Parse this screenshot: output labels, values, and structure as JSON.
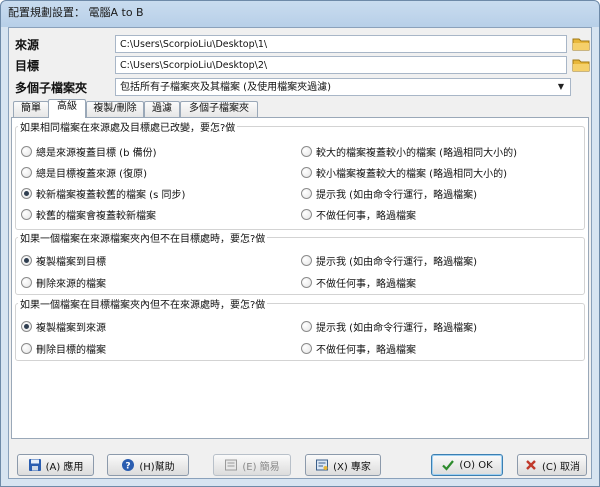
{
  "window": {
    "title": "配置規劃設置： 電腦A to B"
  },
  "rows": {
    "source_label": "來源",
    "source_path": "C:\\Users\\ScorpioLiu\\Desktop\\1\\",
    "target_label": "目標",
    "target_path": "C:\\Users\\ScorpioLiu\\Desktop\\2\\",
    "subfolders_label": "多個子檔案夾",
    "subfolders_value": "包括所有子檔案夾及其檔案 (及使用檔案夾過濾)"
  },
  "tabs": [
    "簡單",
    "高級",
    "複製/刪除",
    "過濾",
    "多個子檔案夾"
  ],
  "groups": {
    "changed": {
      "title": "如果相同檔案在來源處及目標處已改變，要怎?做",
      "left": [
        "總是來源複蓋目標 (b 備份)",
        "總是目標複蓋來源 (復原)",
        "較新檔案複蓋較舊的檔案 (s 同步)",
        "較舊的檔案會複蓋較新檔案"
      ],
      "right": [
        "較大的檔案複蓋較小的檔案 (略過相同大小的)",
        "較小檔案複蓋較大的檔案 (略過相同大小的)",
        "提示我 (如由命令行運行，略過檔案)",
        "不做任何事，略過檔案"
      ]
    },
    "source_only": {
      "title": "如果一個檔案在來源檔案夾內但不在目標處時，要怎?做",
      "left": [
        "複製檔案到目標",
        "刪除來源的檔案"
      ],
      "right": [
        "提示我 (如由命令行運行，略過檔案)",
        "不做任何事，略過檔案"
      ]
    },
    "target_only": {
      "title": "如果一個檔案在目標檔案夾內但不在來源處時，要怎?做",
      "left": [
        "複製檔案到來源",
        "刪除目標的檔案"
      ],
      "right": [
        "提示我 (如由命令行運行，略過檔案)",
        "不做任何事，略過檔案"
      ]
    }
  },
  "buttons": {
    "apply": "(A) 應用",
    "help": "(H)幫助",
    "simple": "(E) 簡易",
    "expert": "(X) 專家",
    "ok": "(O) OK",
    "cancel": "(C) 取消"
  },
  "colors": {
    "selection": "#2f3e50",
    "folder": "#e8b73a",
    "ok_check": "#2d8b2d",
    "cancel_x": "#c0392b",
    "save": "#2a5db0"
  }
}
